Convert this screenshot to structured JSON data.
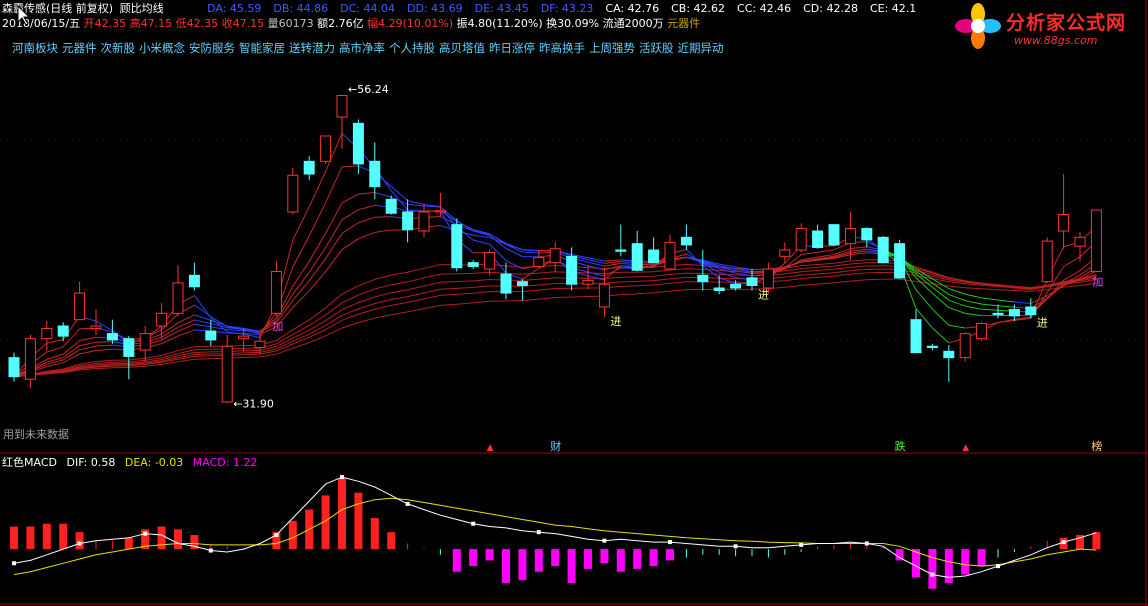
{
  "header": {
    "name": "森霸传感(日线 前复权)",
    "indicator": "顾比均线",
    "ma_values": [
      {
        "label": "DA: 45.59",
        "color": "#3d5bff"
      },
      {
        "label": "DB: 44.86",
        "color": "#3d5bff"
      },
      {
        "label": "DC: 44.04",
        "color": "#3d5bff"
      },
      {
        "label": "DD: 43.69",
        "color": "#3d5bff"
      },
      {
        "label": "DE: 43.45",
        "color": "#3d5bff"
      },
      {
        "label": "DF: 43.23",
        "color": "#3d5bff"
      },
      {
        "label": "CA: 42.76",
        "color": "#ffffff"
      },
      {
        "label": "CB: 42.62",
        "color": "#ffffff"
      },
      {
        "label": "CC: 42.46",
        "color": "#ffffff"
      },
      {
        "label": "CD: 42.28",
        "color": "#ffffff"
      },
      {
        "label": "CE: 42.1",
        "color": "#ffffff"
      }
    ]
  },
  "quote": {
    "date": "2018/06/15/五",
    "open": "开42.35",
    "high": "高47.15",
    "low": "低42.35",
    "close": "收47.15",
    "volume": "量60173",
    "amount": "额2.76亿",
    "change": "幅4.29(10.01%)",
    "amplitude": "振4.80(11.20%)",
    "turnover": "换30.09%",
    "float": "流通2000万",
    "sector": "元器件"
  },
  "concept_tags": [
    "河南板块",
    "元器件",
    "次新股",
    "小米概念",
    "安防服务",
    "智能家居",
    "送转潜力",
    "高市净率",
    "个人持股",
    "高贝塔值",
    "昨日涨停",
    "昨高换手",
    "上周强势",
    "活跃股",
    "近期异动"
  ],
  "logo": {
    "title": "分析家公式网",
    "url": "www.88gs.com"
  },
  "future_notice": "用到未来数据",
  "colors": {
    "up": "#ff3232",
    "down": "#54ffff",
    "ma_blue": "#2f3cff",
    "ma_red": "#c81e1e",
    "ma_green": "#1ec81e",
    "macd_pink": "#ff00ff"
  },
  "chart_data": [
    {
      "type": "candlestick",
      "title": "顾比均线",
      "ylim": [
        29,
        59
      ],
      "annotations": [
        {
          "text": "56.24",
          "index": 20
        },
        {
          "text": "31.90",
          "index": 13
        },
        {
          "text": "加",
          "index": 16
        },
        {
          "text": "进",
          "index": 36
        },
        {
          "text": "进",
          "index": 45
        },
        {
          "text": "进",
          "index": 62
        },
        {
          "text": "加",
          "index": 66
        }
      ],
      "event_markers": [
        {
          "text": "财",
          "index": 33
        },
        {
          "text": "跌",
          "index": 54
        },
        {
          "text": "榜",
          "index": 66
        }
      ],
      "candles": [
        [
          35.5,
          35.9,
          33.6,
          34.0
        ],
        [
          33.8,
          37.3,
          33.1,
          37.0
        ],
        [
          37.0,
          38.4,
          36.0,
          37.8
        ],
        [
          38.0,
          38.3,
          36.8,
          37.2
        ],
        [
          38.5,
          41.5,
          38.5,
          40.6
        ],
        [
          37.8,
          39.3,
          37.3,
          38.0
        ],
        [
          37.4,
          38.5,
          36.6,
          36.9
        ],
        [
          37.0,
          37.2,
          33.8,
          35.6
        ],
        [
          36.1,
          38.0,
          35.2,
          37.4
        ],
        [
          38.0,
          39.8,
          37.0,
          39.0
        ],
        [
          39.0,
          42.8,
          38.8,
          41.4
        ],
        [
          42.0,
          43.0,
          40.8,
          41.1
        ],
        [
          37.6,
          38.5,
          36.4,
          36.9
        ],
        [
          32.0,
          37.3,
          31.9,
          36.4
        ],
        [
          37.0,
          37.8,
          36.0,
          37.2
        ],
        [
          36.3,
          37.3,
          35.8,
          36.8
        ],
        [
          39.0,
          43.1,
          38.8,
          42.3
        ],
        [
          47.0,
          50.5,
          46.8,
          49.9
        ],
        [
          51.0,
          51.4,
          49.5,
          50.0
        ],
        [
          51.0,
          53.0,
          50.8,
          53.0
        ],
        [
          54.5,
          56.24,
          52.0,
          56.2
        ],
        [
          54.0,
          54.3,
          50.0,
          50.8
        ],
        [
          51.0,
          52.5,
          48.0,
          49.0
        ],
        [
          48.0,
          48.3,
          46.8,
          46.9
        ],
        [
          47.0,
          48.0,
          44.6,
          45.6
        ],
        [
          45.5,
          47.6,
          45.0,
          47.0
        ],
        [
          47.0,
          48.5,
          46.6,
          47.1
        ],
        [
          46.0,
          46.5,
          42.3,
          42.6
        ],
        [
          43.0,
          43.2,
          42.5,
          42.7
        ],
        [
          42.5,
          44.0,
          42.0,
          43.8
        ],
        [
          42.1,
          43.0,
          40.1,
          40.6
        ],
        [
          41.5,
          41.7,
          40.0,
          41.2
        ],
        [
          42.7,
          44.0,
          42.6,
          43.4
        ],
        [
          43.0,
          44.6,
          42.3,
          44.1
        ],
        [
          43.5,
          44.2,
          40.8,
          41.3
        ],
        [
          41.3,
          42.8,
          40.9,
          41.6
        ],
        [
          39.5,
          42.6,
          38.7,
          41.3
        ],
        [
          44.0,
          46.0,
          43.5,
          43.9
        ],
        [
          44.5,
          45.5,
          42.3,
          42.4
        ],
        [
          44.0,
          45.0,
          43.0,
          43.0
        ],
        [
          42.5,
          45.2,
          42.5,
          44.6
        ],
        [
          45.0,
          46.0,
          44.0,
          44.4
        ],
        [
          42.0,
          44.0,
          40.8,
          41.5
        ],
        [
          41.0,
          42.0,
          40.5,
          40.8
        ],
        [
          41.3,
          41.6,
          40.8,
          41.0
        ],
        [
          41.8,
          42.5,
          40.8,
          41.2
        ],
        [
          41.0,
          43.0,
          40.6,
          42.5
        ],
        [
          43.5,
          44.6,
          43.0,
          44.0
        ],
        [
          44.0,
          46.1,
          43.8,
          45.7
        ],
        [
          45.5,
          46.0,
          44.1,
          44.2
        ],
        [
          46.0,
          46.0,
          44.3,
          44.4
        ],
        [
          44.5,
          47.0,
          43.2,
          45.7
        ],
        [
          45.7,
          45.8,
          44.2,
          44.8
        ],
        [
          45.0,
          45.1,
          43.0,
          43.0
        ],
        [
          44.5,
          44.8,
          41.7,
          41.8
        ],
        [
          38.5,
          39.3,
          35.9,
          35.9
        ],
        [
          36.4,
          36.6,
          36.1,
          36.3
        ],
        [
          36.0,
          36.5,
          33.6,
          35.5
        ],
        [
          35.5,
          37.5,
          35.2,
          37.4
        ],
        [
          37.0,
          38.3,
          36.8,
          38.2
        ],
        [
          39.0,
          39.7,
          38.6,
          38.9
        ],
        [
          39.3,
          39.7,
          38.4,
          38.8
        ],
        [
          39.5,
          40.2,
          38.6,
          38.9
        ],
        [
          41.5,
          45.0,
          41.4,
          44.7
        ],
        [
          45.5,
          50.0,
          44.1,
          46.8
        ],
        [
          44.3,
          45.4,
          43.1,
          45.0
        ],
        [
          42.3,
          47.2,
          42.3,
          47.15
        ]
      ]
    },
    {
      "type": "bar",
      "title": "红色MACD",
      "legend": [
        "DIF: 0.58",
        "DEA: -0.03",
        "MACD: 1.22"
      ],
      "ylim": [
        -1.8,
        2.8
      ],
      "macd": [
        0.8,
        0.8,
        0.9,
        0.9,
        0.6,
        0.3,
        0.3,
        0.4,
        0.7,
        0.8,
        0.7,
        0.5,
        0.2,
        0.1,
        0.05,
        0.05,
        0.6,
        1.0,
        1.4,
        1.9,
        2.5,
        2.0,
        1.1,
        0.6,
        0.2,
        0.02,
        -0.2,
        -0.8,
        -0.6,
        -0.4,
        -1.2,
        -1.1,
        -0.8,
        -0.6,
        -1.2,
        -0.7,
        -0.5,
        -0.8,
        -0.7,
        -0.6,
        -0.4,
        -0.3,
        -0.2,
        -0.2,
        -0.25,
        -0.25,
        -0.3,
        -0.2,
        -0.1,
        0.1,
        0.15,
        0.2,
        0.2,
        0.1,
        -0.4,
        -1.0,
        -1.4,
        -1.2,
        -0.9,
        -0.6,
        -0.3,
        -0.1,
        0.1,
        0.3,
        0.4,
        0.5,
        0.6
      ],
      "dif": [
        -0.5,
        -0.4,
        -0.2,
        0.0,
        0.2,
        0.3,
        0.35,
        0.4,
        0.55,
        0.5,
        0.2,
        0.1,
        -0.05,
        -0.1,
        0.0,
        0.2,
        0.5,
        1.1,
        1.7,
        2.3,
        2.55,
        2.4,
        2.2,
        1.9,
        1.6,
        1.4,
        1.2,
        1.05,
        0.9,
        0.8,
        0.75,
        0.65,
        0.6,
        0.55,
        0.45,
        0.35,
        0.3,
        0.35,
        0.3,
        0.25,
        0.25,
        0.2,
        0.15,
        0.1,
        0.1,
        0.05,
        0.05,
        0.1,
        0.15,
        0.2,
        0.2,
        0.25,
        0.2,
        0.1,
        -0.3,
        -0.6,
        -0.9,
        -1.0,
        -0.95,
        -0.8,
        -0.6,
        -0.4,
        -0.2,
        0.05,
        0.25,
        0.4,
        0.58
      ],
      "dea": [
        -0.9,
        -0.8,
        -0.65,
        -0.5,
        -0.35,
        -0.2,
        -0.1,
        0.0,
        0.1,
        0.15,
        0.2,
        0.2,
        0.15,
        0.15,
        0.15,
        0.15,
        0.2,
        0.4,
        0.7,
        1.0,
        1.4,
        1.6,
        1.75,
        1.8,
        1.75,
        1.65,
        1.55,
        1.45,
        1.35,
        1.25,
        1.15,
        1.05,
        0.95,
        0.85,
        0.8,
        0.72,
        0.65,
        0.6,
        0.55,
        0.5,
        0.45,
        0.4,
        0.37,
        0.33,
        0.3,
        0.28,
        0.25,
        0.23,
        0.22,
        0.2,
        0.2,
        0.2,
        0.2,
        0.2,
        0.1,
        -0.1,
        -0.3,
        -0.45,
        -0.55,
        -0.6,
        -0.55,
        -0.45,
        -0.35,
        -0.2,
        -0.1,
        0.0,
        -0.03
      ]
    }
  ]
}
